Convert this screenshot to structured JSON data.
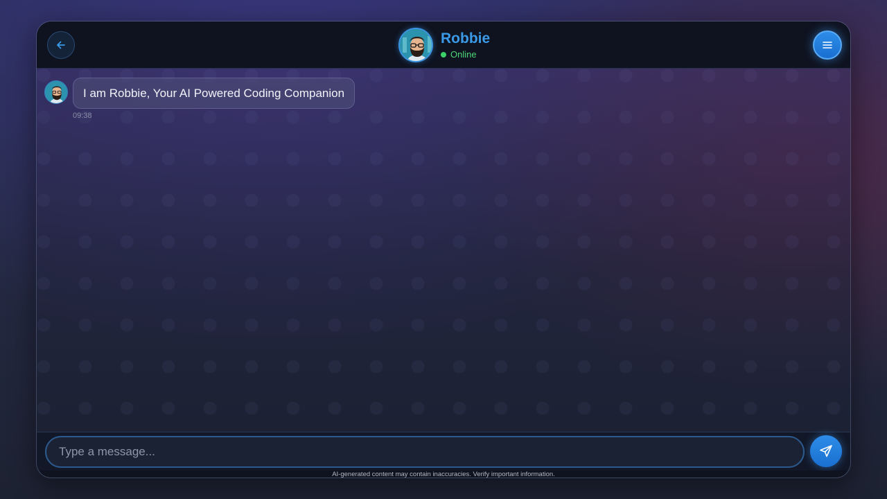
{
  "header": {
    "bot_name": "Robbie",
    "status": "Online",
    "back_icon": "arrow-left-icon",
    "menu_icon": "hamburger-menu-icon",
    "accent_color": "#2d8de8",
    "status_color": "#3cd06a"
  },
  "messages": [
    {
      "sender": "Robbie",
      "text": "I am Robbie, Your AI Powered Coding Companion",
      "time": "09:38"
    }
  ],
  "composer": {
    "placeholder": "Type a message...",
    "value": "",
    "send_icon": "send-paper-plane-icon"
  },
  "footer": {
    "disclaimer": "AI-generated content may contain inaccuracies. Verify important information."
  }
}
